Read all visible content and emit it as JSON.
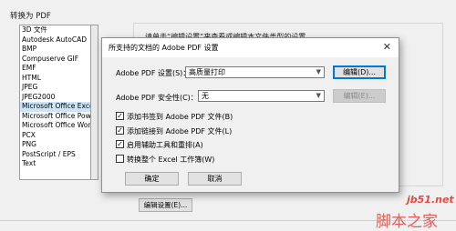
{
  "section_title": "转换为 PDF",
  "file_types": [
    "3D 文件",
    "Autodesk AutoCAD",
    "BMP",
    "Compuserve GIF",
    "EMF",
    "HTML",
    "JPEG",
    "JPEG2000",
    "Microsoft Office Excel",
    "Microsoft Office Power",
    "Microsoft Office Word",
    "PCX",
    "PNG",
    "PostScript / EPS",
    "Text"
  ],
  "selected_file_type": "Microsoft Office Excel",
  "hint_text": "请单击“编辑设置”来查看或编辑本文件类型的设置。",
  "edit_settings_button": "编辑设置(E)...",
  "dialog": {
    "title": "所支持的文档的 Adobe PDF 设置",
    "close_glyph": "✕",
    "settings_label": "Adobe PDF 设置(S)：",
    "settings_value": "高质量打印",
    "edit_button": "编辑(D)...",
    "security_label": "Adobe PDF 安全性(C)：",
    "security_value": "无",
    "security_edit_button": "编辑(E)...",
    "options": [
      {
        "label": "添加书签到 Adobe PDF 文件(B)",
        "checked": true
      },
      {
        "label": "添加链接到 Adobe PDF 文件(L)",
        "checked": true
      },
      {
        "label": "启用辅助工具和重排(A)",
        "checked": true
      },
      {
        "label": "转换整个 Excel 工作簿(W)",
        "checked": false
      }
    ],
    "ok_button": "确定",
    "cancel_button": "取消"
  },
  "watermark": {
    "site": "jb51.net",
    "name": "脚本之家"
  },
  "colors": {
    "selection": "#cce4f7",
    "focus_border": "#0078d7",
    "watermark": "#e24a44"
  }
}
